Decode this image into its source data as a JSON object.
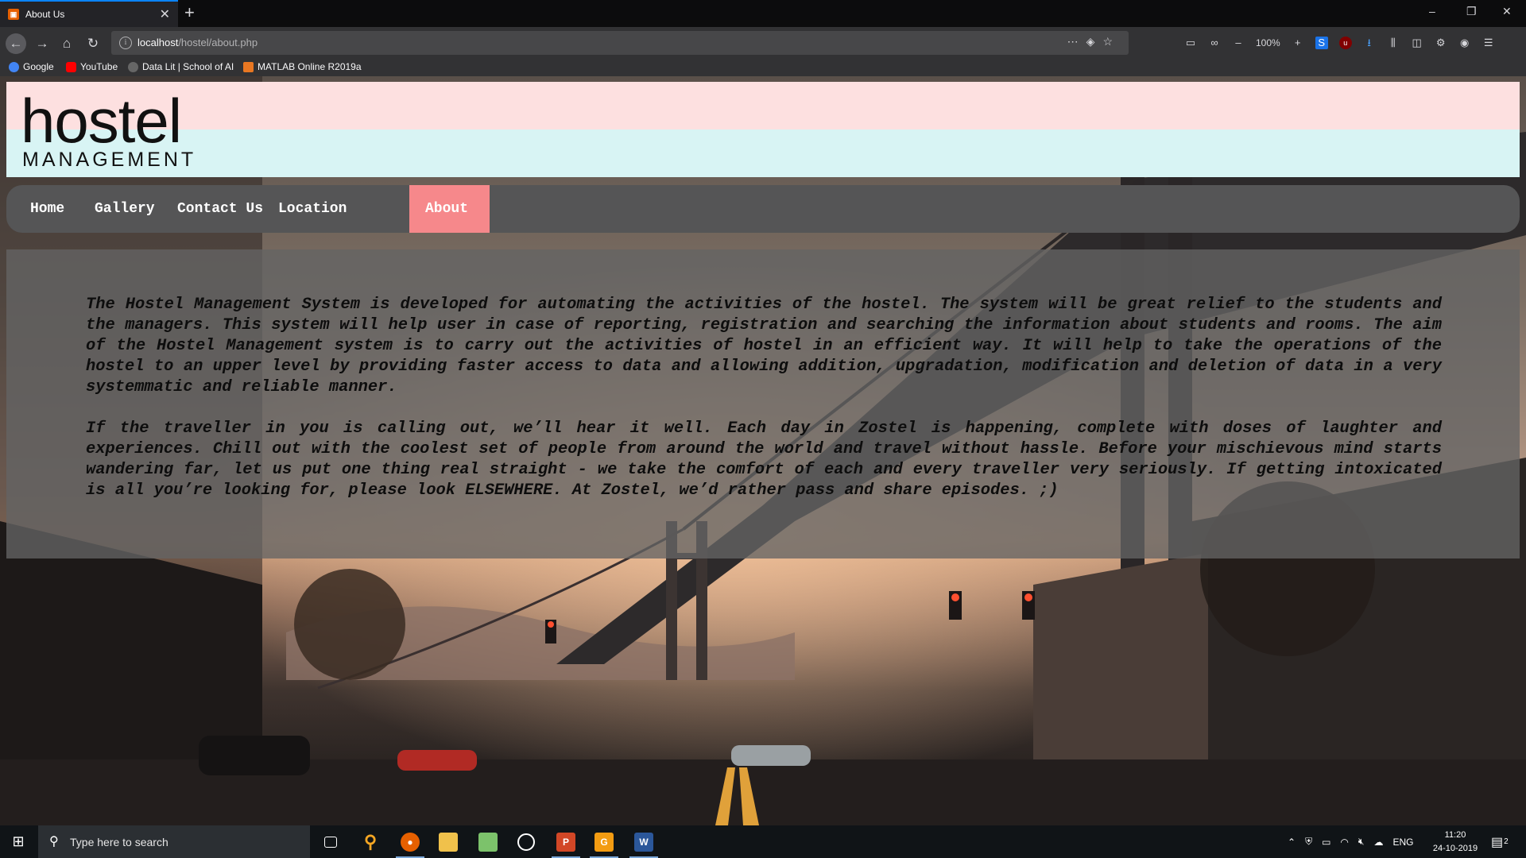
{
  "browser": {
    "tab_title": "About Us",
    "tab_close": "✕",
    "new_tab": "+",
    "url_host": "localhost",
    "url_path": "/hostel/about.php",
    "zoom": "100%",
    "window_controls": {
      "minimize": "–",
      "restore": "❐",
      "close": "✕"
    },
    "bookmarks": [
      {
        "label": "Google",
        "color": "#4285f4"
      },
      {
        "label": "YouTube",
        "color": "#ff0000"
      },
      {
        "label": "Data Lit | School of AI",
        "color": "#666666"
      },
      {
        "label": "MATLAB Online R2019a",
        "color": "#e87722"
      }
    ]
  },
  "page": {
    "logo": {
      "word": "hostel",
      "sub": "MANAGEMENT"
    },
    "nav": [
      {
        "label": "Home",
        "active": false
      },
      {
        "label": "Gallery",
        "active": false
      },
      {
        "label": "Contact Us",
        "active": false
      },
      {
        "label": "Location",
        "active": false
      },
      {
        "label": "About",
        "active": true
      }
    ],
    "paragraphs": [
      "The Hostel Management System is developed for automating the activities of the hostel. The system will be great relief to the students and the managers. This system will help user in case of reporting, registration and searching the information about students and rooms. The aim of the Hostel Management system is to carry out the activities of hostel in an efficient way. It will help to take the operations of the hostel to an upper level by providing faster access to data and allowing addition, upgradation, modification and deletion of data in a very systemmatic and reliable manner.",
      "If the traveller in you is calling out, we’ll hear it well. Each day in Zostel is happening, complete with doses of laughter and experiences. Chill out with the coolest set of people from around the world and travel without hassle. Before your mischievous mind starts wandering far, let us put one thing real straight - we take the comfort of each and every traveller very seriously. If getting intoxicated is all you’re looking for, please look ELSEWHERE. At Zostel, we’d rather pass and share episodes. ;)"
    ],
    "colors": {
      "header_top": "#fde0e0",
      "header_bottom": "#d8f4f4",
      "nav_bg": "#555556",
      "nav_active": "#f6888b"
    }
  },
  "taskbar": {
    "search_placeholder": "Type here to search",
    "language": "ENG",
    "time": "11:20",
    "date": "24-10-2019",
    "notification_count": "2"
  }
}
